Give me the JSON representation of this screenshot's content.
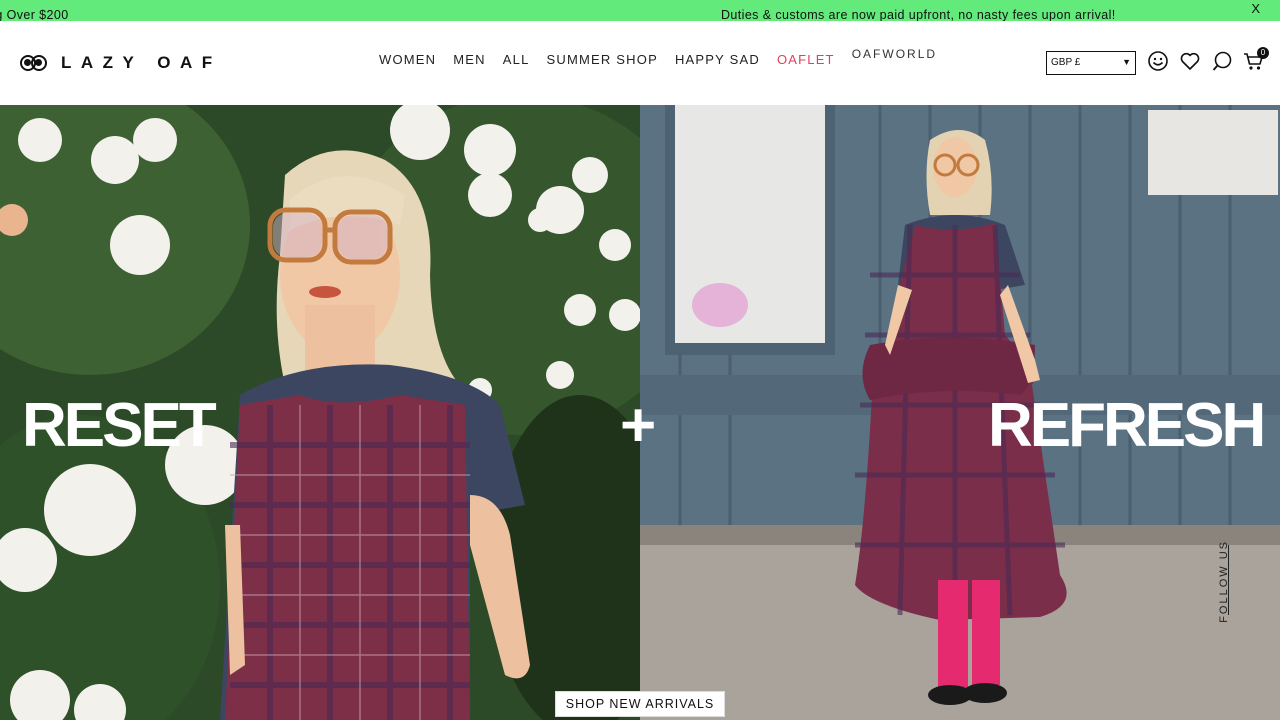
{
  "promo": {
    "left_text": "ng Over $200",
    "right_text": "Duties & customs are now paid upfront, no nasty fees upon arrival!",
    "close_label": "X"
  },
  "brand": {
    "name": "LAZY OAF"
  },
  "nav": {
    "items": [
      {
        "label": "WOMEN"
      },
      {
        "label": "MEN"
      },
      {
        "label": "ALL"
      },
      {
        "label": "SUMMER SHOP"
      },
      {
        "label": "HAPPY SAD"
      },
      {
        "label": "OAFLET"
      },
      {
        "label": "OAFWORLD"
      }
    ]
  },
  "header": {
    "currency": "GBP £",
    "cart_count": "0"
  },
  "icons": {
    "account": "smiley-icon",
    "wishlist": "heart-icon",
    "search": "search-icon",
    "cart": "cart-icon"
  },
  "hero": {
    "word_left": "RESET",
    "word_mid": "+",
    "word_right": "REFRESH",
    "cta": "SHOP NEW ARRIVALS",
    "follow": "FOLLOW US"
  },
  "colors": {
    "promo_bg": "#62ea7b",
    "accent_oaflet": "#e0415b"
  }
}
